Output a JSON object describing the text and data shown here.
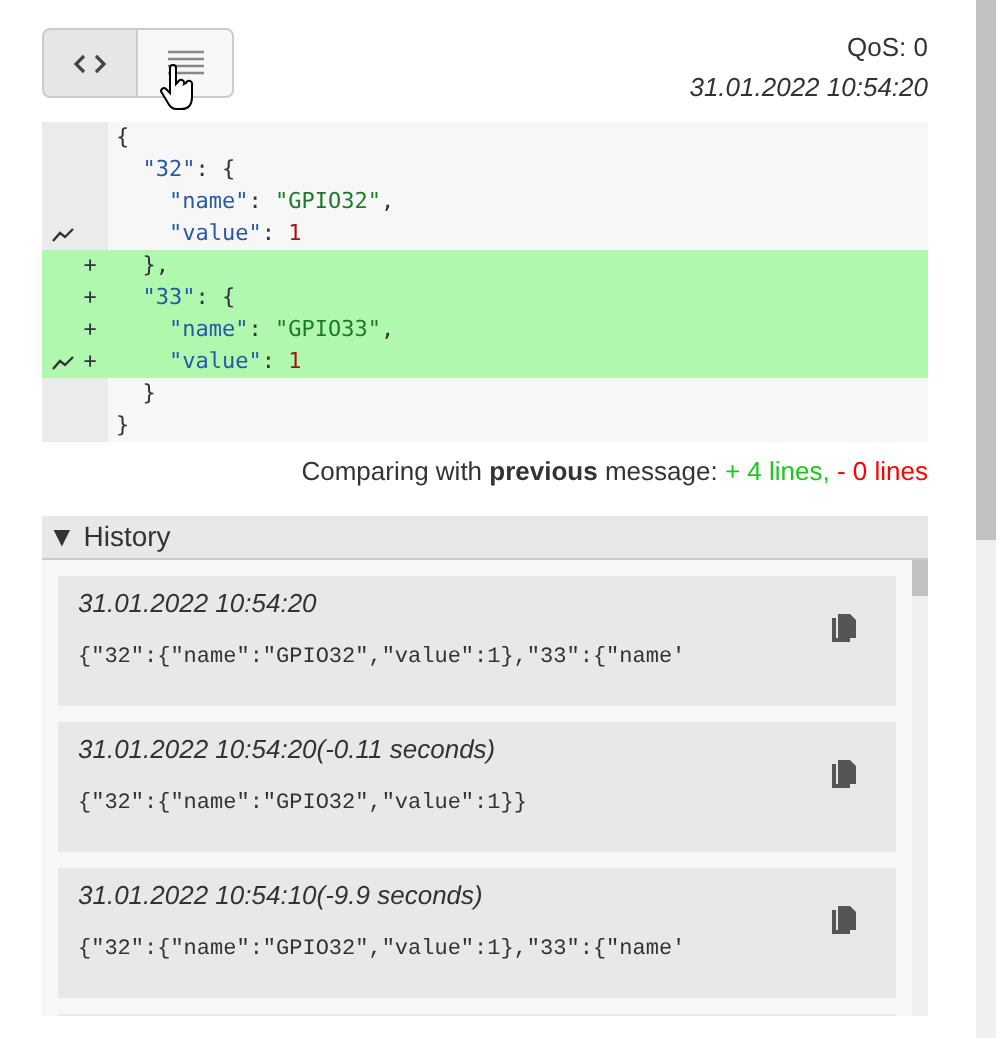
{
  "view_toggle": [
    {
      "kind": "code",
      "selected": true
    },
    {
      "kind": "list",
      "selected": false
    }
  ],
  "qos": "QoS: 0",
  "timestamp": "31.01.2022 10:54:20",
  "diff": {
    "lines": [
      {
        "added": false,
        "changed": false,
        "tokens": [
          {
            "kind": "punct",
            "text": "{"
          }
        ]
      },
      {
        "added": false,
        "changed": false,
        "tokens": [
          {
            "kind": "key",
            "text": "  \"32\""
          },
          {
            "kind": "punct",
            "text": ": {"
          }
        ]
      },
      {
        "added": false,
        "changed": false,
        "tokens": [
          {
            "kind": "key",
            "text": "    \"name\""
          },
          {
            "kind": "punct",
            "text": ": "
          },
          {
            "kind": "string",
            "text": "\"GPIO32\""
          },
          {
            "kind": "punct",
            "text": ","
          }
        ]
      },
      {
        "added": false,
        "changed": true,
        "tokens": [
          {
            "kind": "key",
            "text": "    \"value\""
          },
          {
            "kind": "punct",
            "text": ": "
          },
          {
            "kind": "number",
            "text": "1"
          }
        ]
      },
      {
        "added": true,
        "marker": "+",
        "changed": false,
        "tokens": [
          {
            "kind": "punct",
            "text": "  },"
          }
        ]
      },
      {
        "added": true,
        "marker": "+",
        "changed": false,
        "tokens": [
          {
            "kind": "key",
            "text": "  \"33\""
          },
          {
            "kind": "punct",
            "text": ": {"
          }
        ]
      },
      {
        "added": true,
        "marker": "+",
        "changed": false,
        "tokens": [
          {
            "kind": "key",
            "text": "    \"name\""
          },
          {
            "kind": "punct",
            "text": ": "
          },
          {
            "kind": "string",
            "text": "\"GPIO33\""
          },
          {
            "kind": "punct",
            "text": ","
          }
        ]
      },
      {
        "added": true,
        "marker": "+",
        "changed": true,
        "tokens": [
          {
            "kind": "key",
            "text": "    \"value\""
          },
          {
            "kind": "punct",
            "text": ": "
          },
          {
            "kind": "number",
            "text": "1"
          }
        ]
      },
      {
        "added": false,
        "changed": false,
        "tokens": [
          {
            "kind": "punct",
            "text": "  }"
          }
        ]
      },
      {
        "added": false,
        "changed": false,
        "tokens": [
          {
            "kind": "punct",
            "text": "}"
          }
        ]
      }
    ],
    "summary": "Comparing with **previous** message: ",
    "added_count": "+ 4 lines,",
    "removed_count": "- 0 lines"
  },
  "history": {
    "toggle": "▼",
    "title": "History",
    "expanded": true,
    "items": [
      {
        "time": "31.01.2022 10:54:20",
        "payload": "{\"32\":{\"name\":\"GPIO32\",\"value\":1},\"33\":{\"name'"
      },
      {
        "time": "31.01.2022 10:54:20(-0.11 seconds)",
        "payload": "{\"32\":{\"name\":\"GPIO32\",\"value\":1}}"
      },
      {
        "time": "31.01.2022 10:54:10(-9.9 seconds)",
        "payload": "{\"32\":{\"name\":\"GPIO32\",\"value\":1},\"33\":{\"name'"
      }
    ]
  }
}
